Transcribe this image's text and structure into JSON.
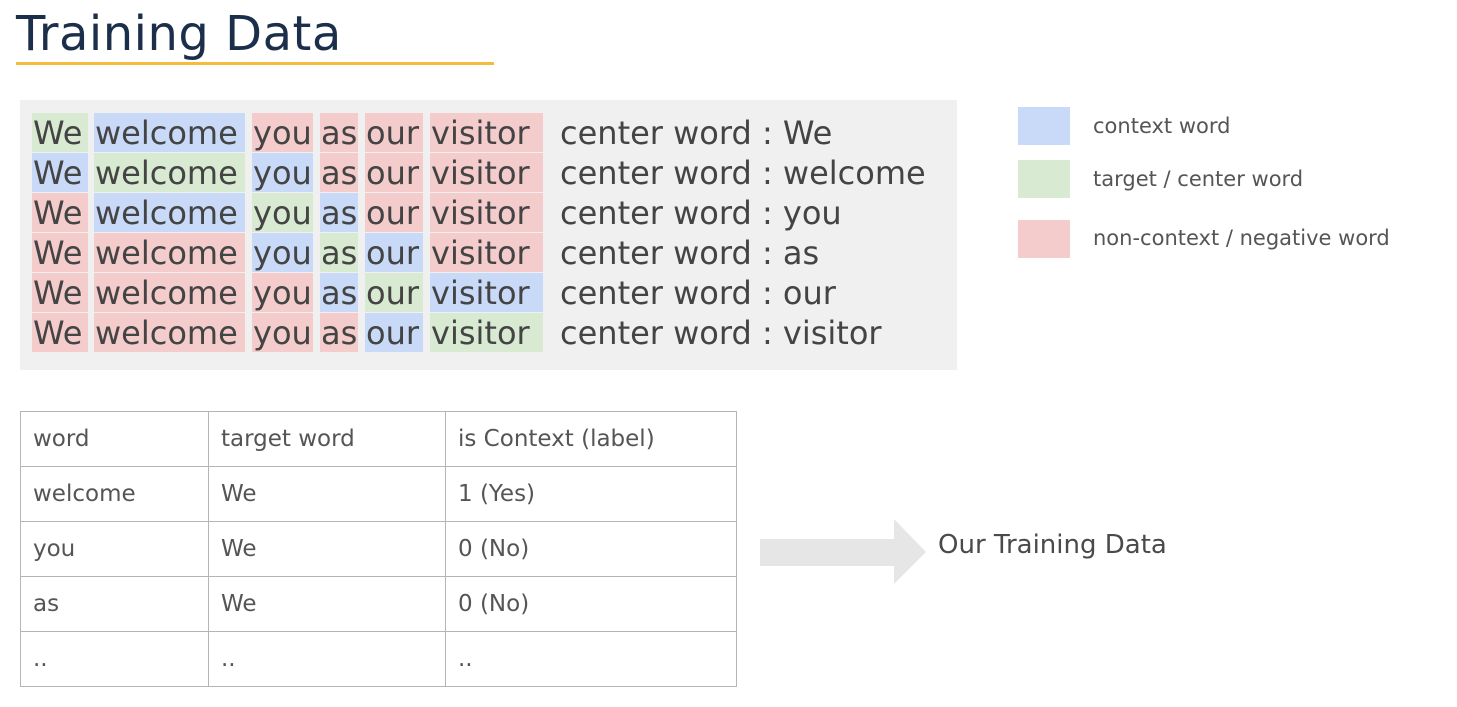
{
  "title": "Training Data",
  "colors": {
    "context": "#c9daf8",
    "target": "#d9ead3",
    "negative": "#f4cccc",
    "panel": "#f0f0f0",
    "title": "#1b2e4a",
    "underline": "#f4bb3c",
    "arrow": "#e6e6e6"
  },
  "sentence_words": [
    "We",
    "welcome",
    "you",
    "as",
    "our",
    "visitor"
  ],
  "rows": [
    {
      "roles": [
        "target",
        "context",
        "negative",
        "negative",
        "negative",
        "negative"
      ],
      "center_label": "center word : We"
    },
    {
      "roles": [
        "context",
        "target",
        "context",
        "negative",
        "negative",
        "negative"
      ],
      "center_label": "center word : welcome"
    },
    {
      "roles": [
        "negative",
        "context",
        "target",
        "context",
        "negative",
        "negative"
      ],
      "center_label": "center word : you"
    },
    {
      "roles": [
        "negative",
        "negative",
        "context",
        "target",
        "context",
        "negative"
      ],
      "center_label": "center word : as"
    },
    {
      "roles": [
        "negative",
        "negative",
        "negative",
        "context",
        "target",
        "context"
      ],
      "center_label": "center word : our"
    },
    {
      "roles": [
        "negative",
        "negative",
        "negative",
        "negative",
        "context",
        "target"
      ],
      "center_label": "center word : visitor"
    }
  ],
  "legend": [
    {
      "role": "context",
      "label": "context word"
    },
    {
      "role": "target",
      "label": "target / center word"
    },
    {
      "role": "negative",
      "label": "non-context / negative word"
    }
  ],
  "table": {
    "headers": [
      "word",
      "target word",
      "is Context (label)"
    ],
    "rows": [
      [
        "welcome",
        "We",
        "1 (Yes)"
      ],
      [
        "you",
        "We",
        "0 (No)"
      ],
      [
        "as",
        "We",
        "0 (No)"
      ],
      [
        "..",
        "..",
        ".."
      ]
    ]
  },
  "arrow_label": "Our Training Data"
}
